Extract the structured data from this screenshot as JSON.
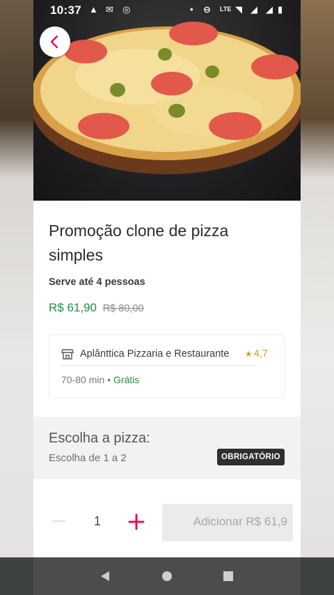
{
  "status_bar": {
    "time": "10:37"
  },
  "product": {
    "title": "Promoção clone de pizza simples",
    "serves": "Serve até 4 pessoas",
    "price": "R$ 61,90",
    "original_price": "R$ 80,00"
  },
  "store": {
    "name": "Aplânttica Pizzaria e Restaurante",
    "rating": "4,7",
    "delivery_time": "70-80 min",
    "delivery_fee": "Grátis",
    "separator": "•"
  },
  "options_section": {
    "title": "Escolha a pizza:",
    "subtitle": "Escolha de 1 a 2",
    "badge": "OBRIGATÓRIO"
  },
  "cart": {
    "quantity": "1",
    "add_label": "Adicionar R$ 61,9"
  },
  "colors": {
    "price_green": "#228a4a",
    "rating_gold": "#c9a227",
    "plus_red": "#e0105a",
    "badge_bg": "#2f2f2f"
  }
}
